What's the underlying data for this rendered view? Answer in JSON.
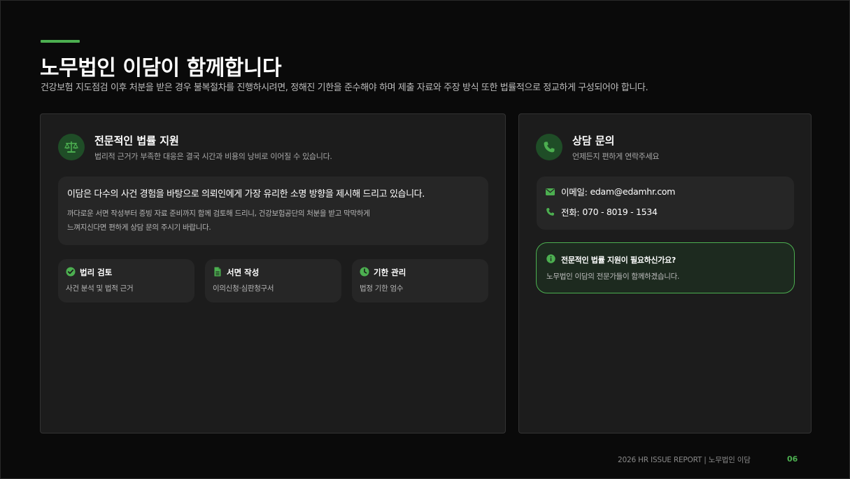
{
  "header": {
    "title": "노무법인 이담이 함께합니다",
    "subtitle": "건강보험 지도점검 이후 처분을 받은 경우 불복절차를 진행하시려면, 정해진 기한을 준수해야 하며 제출 자료와 주장 방식 또한 법률적으로 정교하게 구성되어야 합니다."
  },
  "left_card": {
    "icon": "scale-balance-icon",
    "heading": "전문적인 법률 지원",
    "subheading": "법리적 근거가 부족한 대응은 결국 시간과 비용의 낭비로 이어질 수 있습니다.",
    "main_panel": {
      "lead": "이담은 다수의 사건 경험을 바탕으로 의뢰인에게 가장 유리한 소명 방향을 제시해 드리고 있습니다.",
      "body_line1": "까다로운 서면 작성부터 증빙 자료 준비까지 함께 검토해 드리니, 건강보험공단의 처분을 받고 막막하게",
      "body_line2": "느껴지신다면 편하게 상담 문의 주시기 바랍니다."
    },
    "features": [
      {
        "icon": "check-circle-icon",
        "title": "법리 검토",
        "desc": "사건 분석 및 법적 근거"
      },
      {
        "icon": "document-icon",
        "title": "서면 작성",
        "desc": "이의신청·심판청구서"
      },
      {
        "icon": "clock-icon",
        "title": "기한 관리",
        "desc": "법정 기한 엄수"
      }
    ]
  },
  "right_card": {
    "icon": "phone-icon",
    "heading": "상담 문의",
    "subheading": "언제든지 편하게 연락주세요",
    "email_label": "이메일:",
    "email_value": "edam@edamhr.com",
    "phone_label": "전화:",
    "phone_value": "070 - 8019 - 1534",
    "help_title": "전문적인 법률 지원이 필요하신가요?",
    "help_body": "노무법인 이담의 전문가들이 함께하겠습니다."
  },
  "footer": {
    "report": "2026 HR ISSUE REPORT | 노무법인 이담",
    "page": "06"
  },
  "colors": {
    "accent": "#4caf50",
    "background": "#0a0a0a",
    "card": "#1c1c1c",
    "panel": "#262626"
  }
}
